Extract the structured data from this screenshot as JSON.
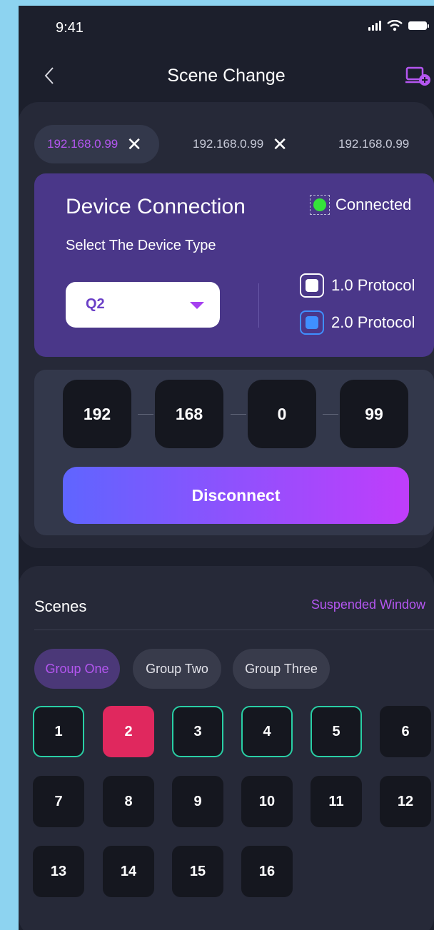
{
  "status": {
    "time": "9:41"
  },
  "nav": {
    "title": "Scene Change"
  },
  "ip_tabs": [
    {
      "label": "192.168.0.99",
      "close": "✕",
      "active": true
    },
    {
      "label": "192.168.0.99",
      "close": "✕",
      "active": false
    },
    {
      "label": "192.168.0.99",
      "close": "",
      "active": false
    }
  ],
  "device": {
    "title": "Device Connection",
    "subtitle": "Select The Device Type",
    "status": "Connected",
    "type_value": "Q2",
    "protocols": [
      {
        "label": "1.0 Protocol"
      },
      {
        "label": "2.0 Protocol",
        "checked": true
      }
    ]
  },
  "ip": {
    "octets": [
      "192",
      "168",
      "0",
      "99"
    ],
    "button": "Disconnect"
  },
  "scenes": {
    "title": "Scenes",
    "link": "Suspended Window",
    "groups": [
      "Group One",
      "Group Two",
      "Group Three"
    ],
    "active_group": 0,
    "items": [
      "1",
      "2",
      "3",
      "4",
      "5",
      "6",
      "7",
      "8",
      "9",
      "10",
      "11",
      "12",
      "13",
      "14",
      "15",
      "16"
    ],
    "selected": "2",
    "ringed": [
      "1",
      "3",
      "4",
      "5"
    ]
  },
  "colors": {
    "accent": "#b456f0",
    "selected": "#e0285e",
    "ring": "#29cfa5",
    "connected": "#35e23a",
    "protocol_checked": "#3f8fff"
  }
}
